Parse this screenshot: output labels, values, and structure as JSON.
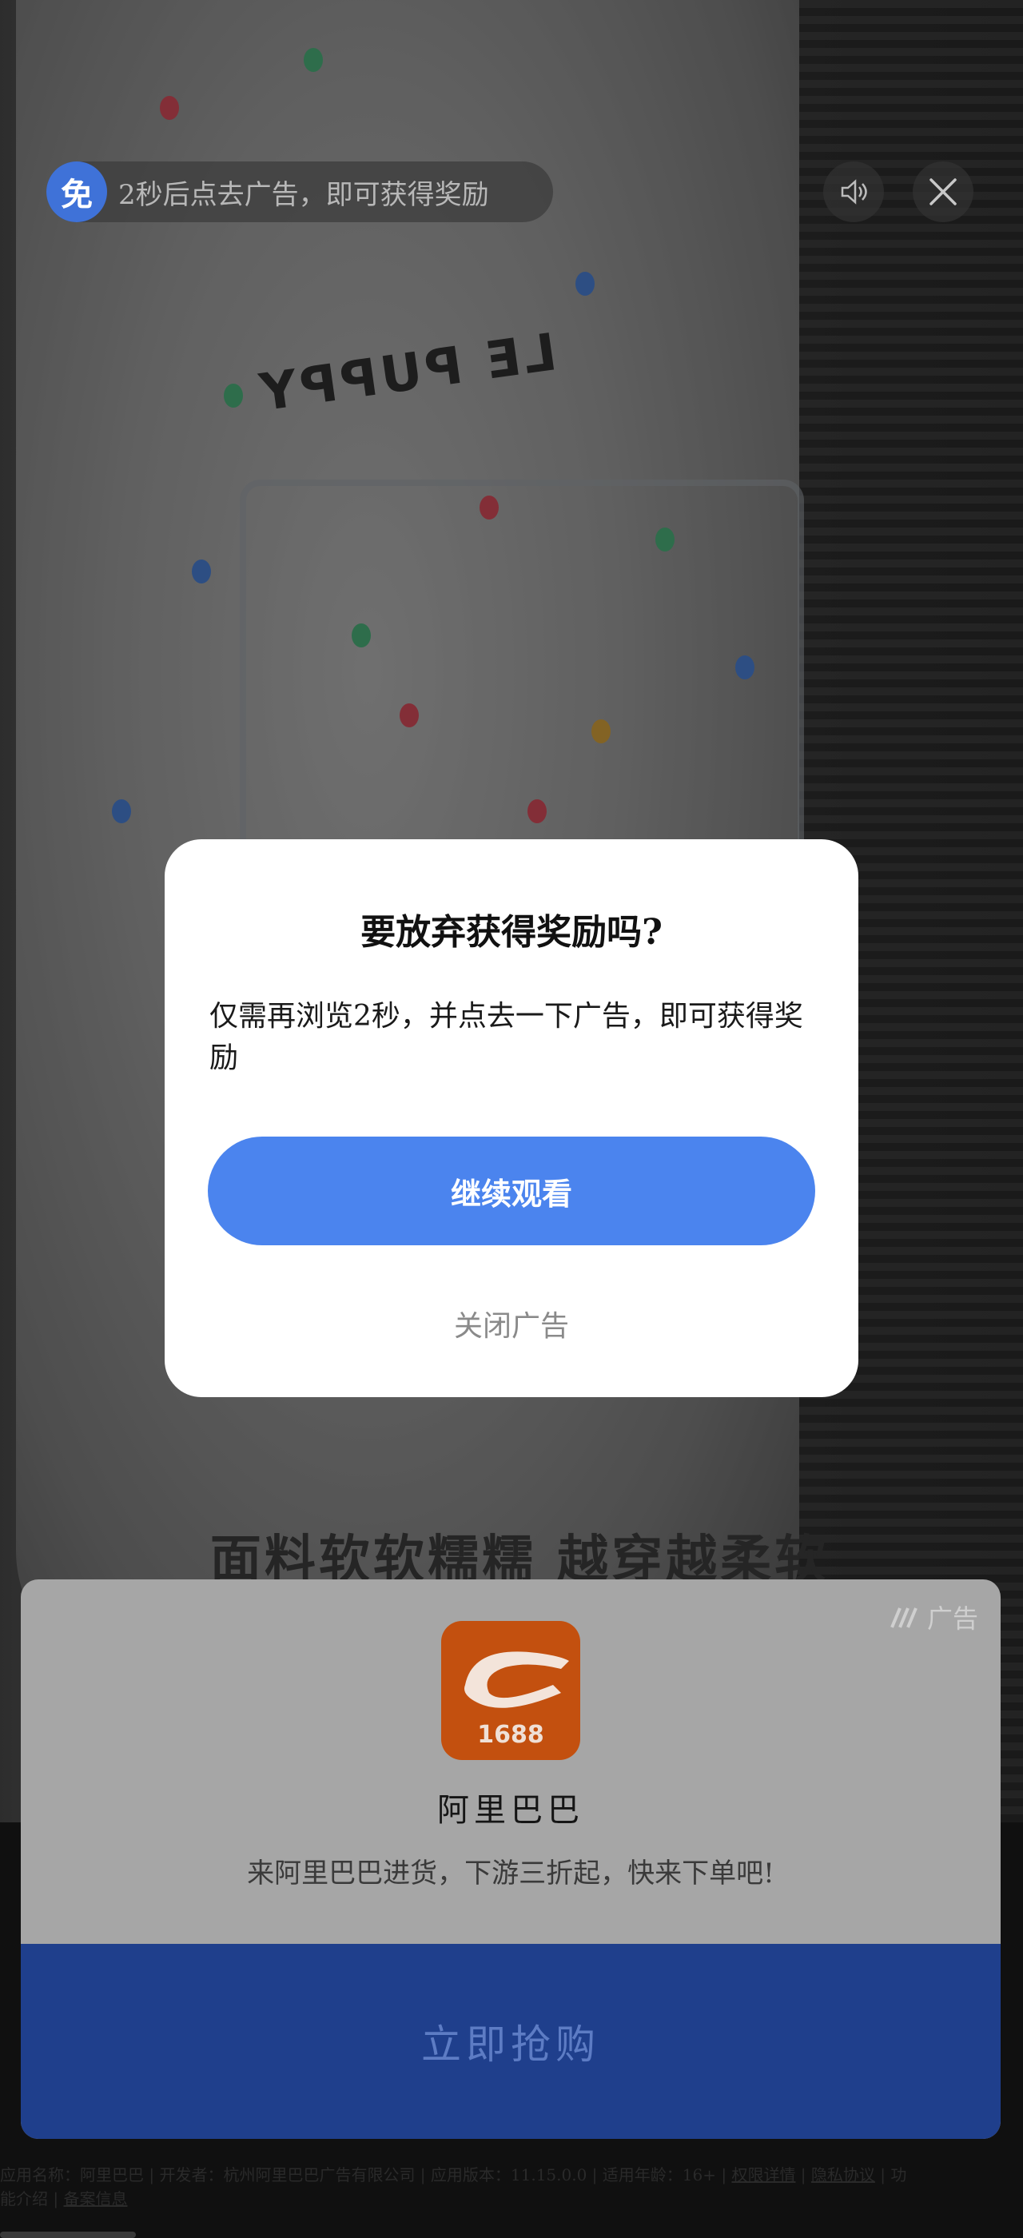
{
  "top_bar": {
    "free_badge": "免",
    "reward_hint": "2秒后点去广告，即可获得奖励",
    "sound_icon": "speaker-icon",
    "close_icon": "close-icon"
  },
  "video": {
    "print_text": "LE PUPPY",
    "subtitle": "面料软软糯糯 越穿越柔软"
  },
  "dialog": {
    "title": "要放弃获得奖励吗?",
    "body": "仅需再浏览2秒，并点去一下广告，即可获得奖励",
    "continue_label": "继续观看",
    "close_label": "关闭广告"
  },
  "ad_card": {
    "ad_label": "广告",
    "app_icon_text": "1688",
    "app_name": "阿里巴巴",
    "description": "来阿里巴巴进货，下游三折起，快来下单吧!",
    "cta_label": "立即抢购"
  },
  "footer": {
    "line1": "应用名称：阿里巴巴 | 开发者：杭州阿里巴巴广告有限公司 | 应用版本：11.15.0.0 | 适用年龄：16+ |",
    "permissions_link": "权限详情",
    "privacy_link": "隐私协议",
    "trailing": "功",
    "line2_prefix": "能介绍 |",
    "filing_link": "备案信息"
  },
  "colors": {
    "accent_blue": "#4b84ee",
    "badge_blue": "#3f72d8",
    "cta_blue": "#1f3f8c",
    "icon_orange": "#c3500f"
  }
}
